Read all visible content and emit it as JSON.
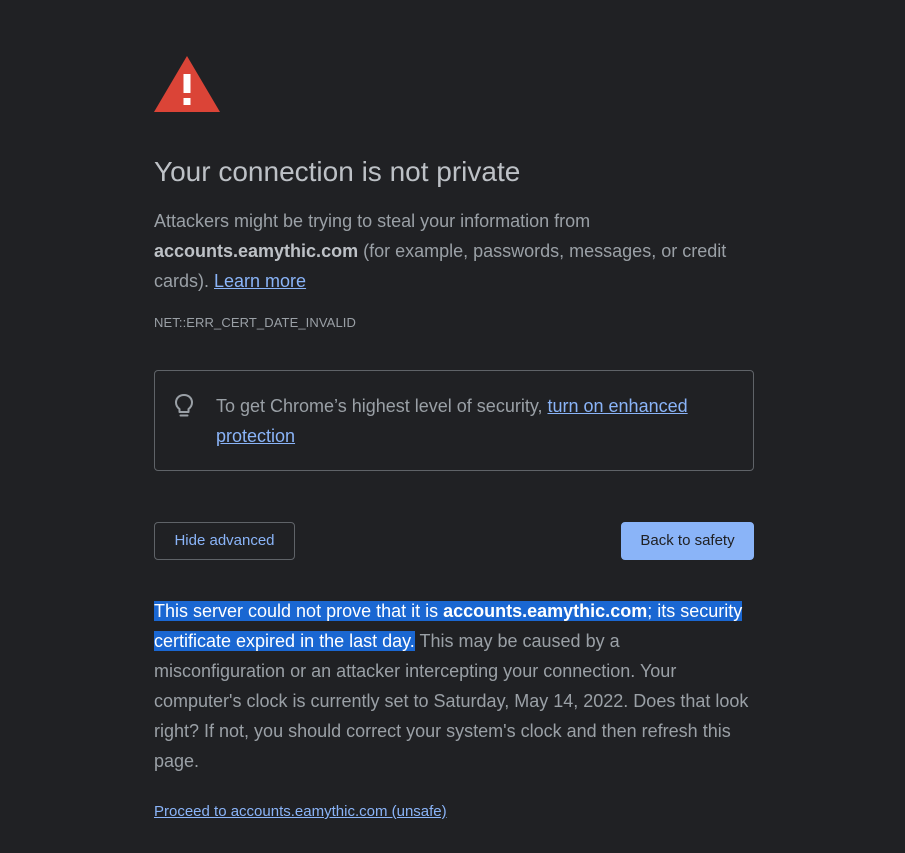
{
  "colors": {
    "background": "#202124",
    "error_red": "#db4437",
    "link": "#8ab4f8",
    "primary_button": "#8ab4f8",
    "selection": "#1a67d2"
  },
  "icons": {
    "warning": "warning-triangle-icon",
    "bulb": "lightbulb-icon"
  },
  "interstitial": {
    "title": "Your connection is not private",
    "message": {
      "prefix": "Attackers might be trying to steal your information from ",
      "domain": "accounts.eamythic.com",
      "suffix": " (for example, passwords, messages, or credit cards). ",
      "learn_more": "Learn more"
    },
    "error_code": "NET::ERR_CERT_DATE_INVALID",
    "enhanced": {
      "text": "To get Chrome’s highest level of security, ",
      "link": "turn on enhanced protection"
    },
    "buttons": {
      "hide_advanced": "Hide advanced",
      "back_to_safety": "Back to safety"
    },
    "details": {
      "sel_prefix": "This server could not prove that it is ",
      "sel_domain": "accounts.eamythic.com",
      "sel_suffix": "; its security certificate expired in the last day.",
      "rest": " This may be caused by a misconfiguration or an attacker intercepting your connection. Your computer's clock is currently set to Saturday, May 14, 2022. Does that look right? If not, you should correct your system's clock and then refresh this page."
    },
    "proceed_link": "Proceed to accounts.eamythic.com (unsafe)"
  }
}
